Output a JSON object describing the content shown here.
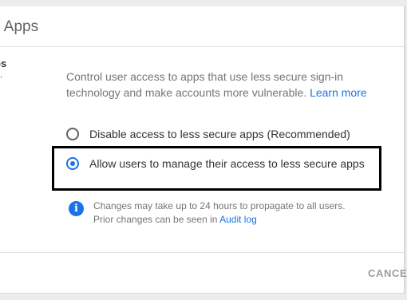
{
  "header": {
    "title": "e Apps"
  },
  "side": {
    "title": "ps",
    "subtitle": "e'"
  },
  "description": {
    "text": "Control user access to apps that use less secure sign-in technology and make accounts more vulnerable.",
    "link": "Learn more"
  },
  "options": [
    {
      "label": "Disable access to less secure apps (Recommended)",
      "selected": false
    },
    {
      "label": "Allow users to manage their access to less secure apps",
      "selected": true
    }
  ],
  "info": {
    "icon": "info-icon",
    "line1": "Changes may take up to 24 hours to propagate to all users.",
    "line2": "Prior changes can be seen in",
    "link": "Audit log"
  },
  "footer": {
    "cancel_label": "CANCEL"
  },
  "colors": {
    "accent": "#1a73e8",
    "highlight_border": "#000000",
    "muted_text": "#757575"
  }
}
